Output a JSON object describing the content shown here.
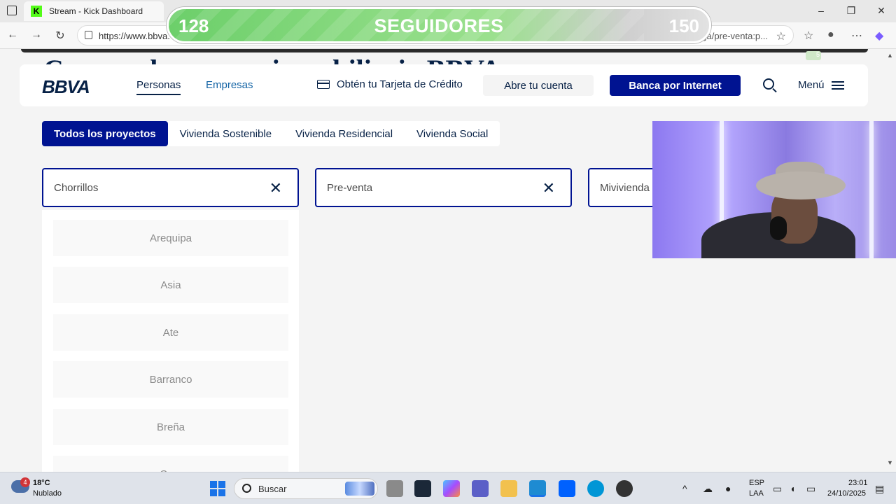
{
  "browser": {
    "tab_title": "Stream - Kick Dashboard",
    "tab_favicon": "K",
    "url_left": "https://www.bbva.",
    "url_right": "rs/inmuebles/entrega/pre-venta:p..."
  },
  "overlay": {
    "current": "128",
    "title": "SEGUIDORES",
    "goal": "150",
    "badge_count": "5"
  },
  "page": {
    "hero_text": "Compra la casa … inmobiliaria BBVA",
    "logo": "BBVA",
    "nav": {
      "personas": "Personas",
      "empresas": "Empresas"
    },
    "card_cta": "Obtén tu Tarjeta de Crédito",
    "abre_cuenta": "Abre tu cuenta",
    "banca_internet": "Banca por Internet",
    "menu": "Menú",
    "filters": [
      "Todos los proyectos",
      "Vivienda Sostenible",
      "Vivienda Residencial",
      "Vivienda Social"
    ],
    "field_district": "Chorrillos",
    "field_stage": "Pre-venta",
    "field_program": "Mivivienda V",
    "options": [
      "Arequipa",
      "Asia",
      "Ate",
      "Barranco",
      "Breña",
      "Ca..."
    ]
  },
  "taskbar": {
    "weather_badge": "4",
    "temp": "18°C",
    "weather": "Nublado",
    "search": "Buscar",
    "lang1": "ESP",
    "lang2": "LAA",
    "time": "23:01",
    "date": "24/10/2025"
  },
  "colors": {
    "bbva_navy": "#072146",
    "bbva_blue": "#001391",
    "kick_green": "#53fc18"
  }
}
